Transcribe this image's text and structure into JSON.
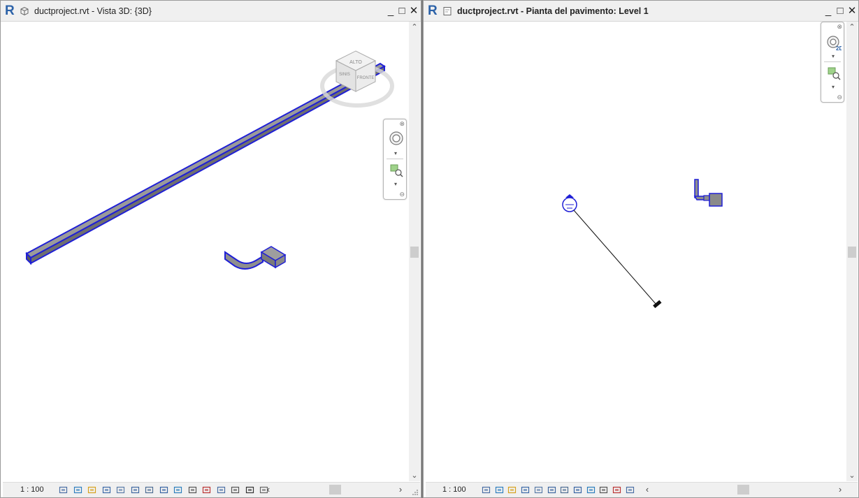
{
  "left_view": {
    "title": "ductproject.rvt - Vista 3D: {3D}",
    "scale": "1 : 100",
    "viewcube_faces": {
      "top": "ALTO",
      "front": "FRONTE",
      "side": "SINIS"
    }
  },
  "right_view": {
    "title": "ductproject.rvt - Pianta del pavimento: Level 1",
    "scale": "1 : 100",
    "nav_2d_label": "2D"
  },
  "window_controls": {
    "minimize": "_",
    "restore": "□",
    "close": "✕"
  },
  "scroll_glyphs": {
    "up": "⌃",
    "down": "⌄",
    "left": "‹",
    "right": "›"
  },
  "colors": {
    "duct_blue": "#1f1fd6",
    "duct_gray": "#8a8a8a",
    "titlebar": "#f0f0f0",
    "revit_blue": "#2c62a8"
  },
  "statusbar_icons_left": [
    "detail-level-icon",
    "visual-style-icon",
    "sun-path-icon",
    "shadows-icon",
    "crop-region-icon",
    "show-crop-icon",
    "unlock-3d-icon",
    "temporary-hide-icon",
    "reveal-hidden-icon",
    "worksharing-icon",
    "analytical-model-icon",
    "highlight-displacement-icon",
    "reveal-constraints-icon",
    "temporary-view-icon",
    "hidden-elements-icon"
  ],
  "statusbar_icons_right": [
    "detail-level-icon",
    "visual-style-icon",
    "sun-path-icon",
    "shadows-icon",
    "crop-region-icon",
    "show-crop-icon",
    "temporary-hide-icon",
    "reveal-hidden-icon",
    "worksharing-icon",
    "analytical-model-icon",
    "reveal-constraints-icon",
    "temporary-view-icon"
  ]
}
